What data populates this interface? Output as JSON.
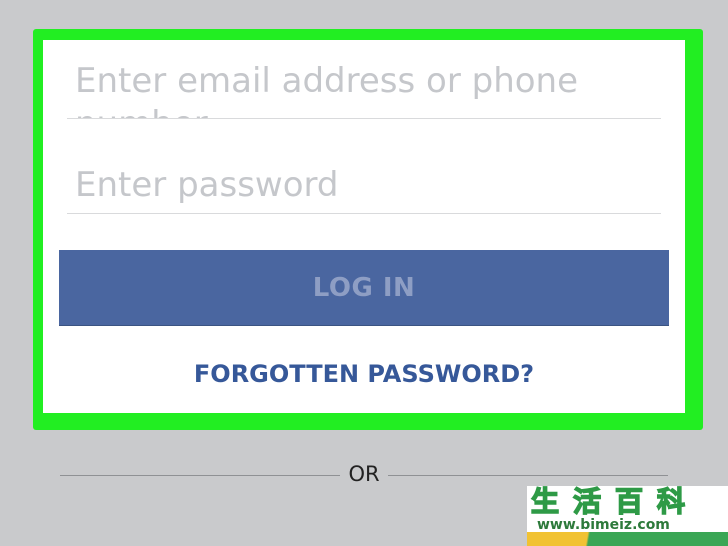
{
  "login_form": {
    "email_placeholder": "Enter email address or phone number",
    "password_placeholder": "Enter password",
    "login_label": "LOG IN",
    "forgot_label": "FORGOTTEN PASSWORD?"
  },
  "divider": {
    "text": "OR"
  },
  "colors": {
    "highlight": "#22ee22",
    "button": "#4a66a0",
    "link": "#365899",
    "background": "#c9cacc"
  },
  "watermark": {
    "logo_text": "生活百科",
    "url": "www.bimeiz.com"
  }
}
